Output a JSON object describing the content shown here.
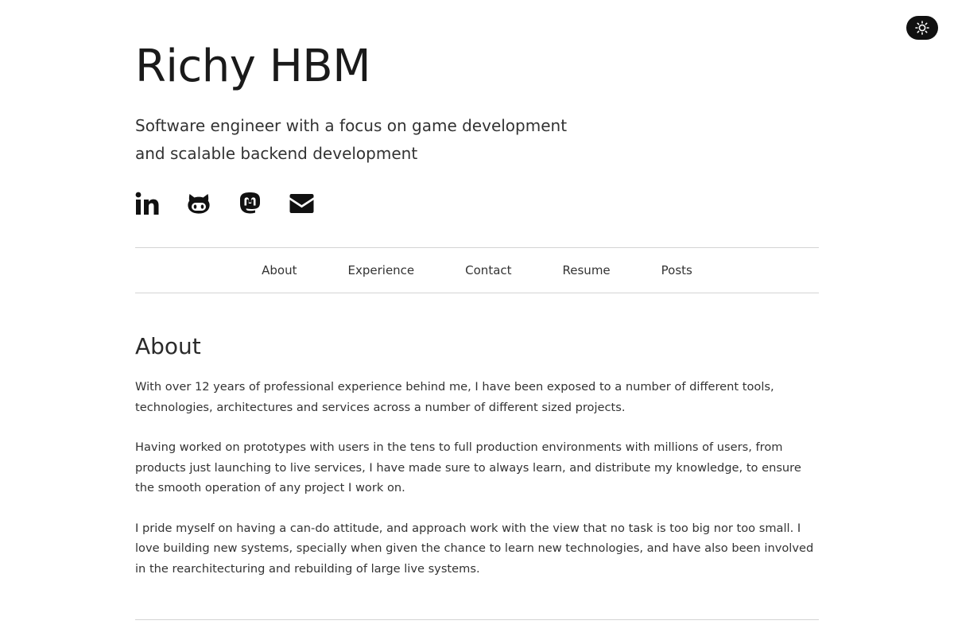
{
  "theme_toggle": {
    "icon": "sun-icon"
  },
  "header": {
    "title": "Richy HBM",
    "tagline_line1": "Software engineer with a focus on game development",
    "tagline_line2": "and scalable backend development"
  },
  "social": [
    {
      "icon": "linkedin-icon"
    },
    {
      "icon": "github-icon"
    },
    {
      "icon": "mastodon-icon"
    },
    {
      "icon": "email-icon"
    }
  ],
  "nav": {
    "items": [
      {
        "label": "About"
      },
      {
        "label": "Experience"
      },
      {
        "label": "Contact"
      },
      {
        "label": "Resume"
      },
      {
        "label": "Posts"
      }
    ]
  },
  "about": {
    "title": "About",
    "paragraphs": [
      "With over 12 years of professional experience behind me, I have been exposed to a number of different tools, technologies, architectures and services across a number of different sized projects.",
      "Having worked on prototypes with users in the tens to full production environments with millions of users, from products just launching to live services, I have made sure to always learn, and distribute my knowledge, to ensure the smooth operation of any project I work on.",
      "I pride myself on having a can-do attitude, and approach work with the view that no task is too big nor too small. I love building new systems, specially when given the chance to learn new technologies, and have also been involved in the rearchitecturing and rebuilding of large live systems."
    ]
  },
  "colors": {
    "text": "#222222",
    "toggle_bg": "#111111",
    "rule": "#d4d4d4"
  }
}
